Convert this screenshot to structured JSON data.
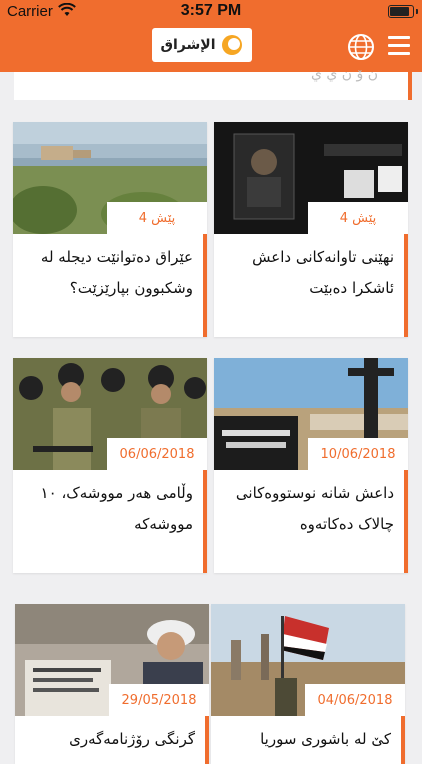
{
  "status_bar": {
    "carrier": "Carrier",
    "time": "3:57 PM"
  },
  "header": {
    "logo_text": "الإشراق",
    "globe_icon": "globe-icon",
    "menu_icon": "hamburger-menu-icon"
  },
  "top_card": {
    "partial_text": "ن ۆ ن ي ي"
  },
  "colors": {
    "accent": "#f06d2e",
    "background": "#efeff1"
  },
  "articles": [
    {
      "badge": "پێش 4",
      "title": "نهێنی تاوانەکانی داعش ئاشکرا دەبێت"
    },
    {
      "badge": "پێش 4",
      "title": "عێراق دەتوانێت دیجلە لە وشکبوون بپارێزێت؟"
    },
    {
      "badge": "10/06/2018",
      "title": "داعش شانە نوستووەکانی چالاک دەکاتەوە"
    },
    {
      "badge": "06/06/2018",
      "title": "وڵامی هەر مووشەک، ١٠ مووشەکە"
    },
    {
      "badge": "04/06/2018",
      "title": "کێ لە باشوری سوریا"
    },
    {
      "badge": "29/05/2018",
      "title": "گرنگی رۆژنامەگەری"
    }
  ]
}
